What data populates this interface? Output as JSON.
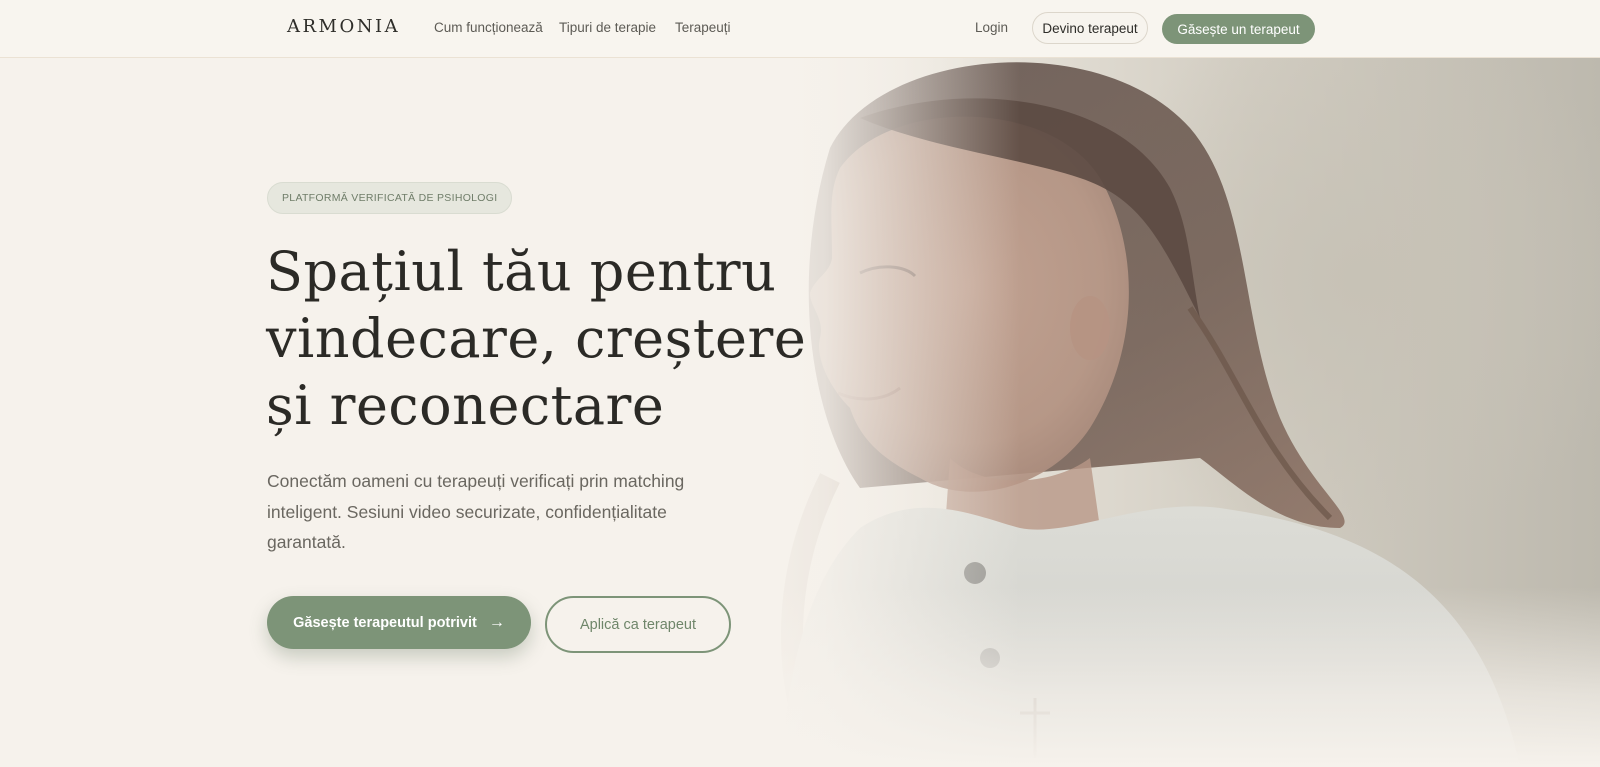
{
  "header": {
    "logo": "ARMONIA",
    "nav": [
      "Cum funcționează",
      "Tipuri de terapie",
      "Terapeuți"
    ],
    "login": "Login",
    "become_therapist": "Devino terapeut",
    "find_therapist": "Găsește un terapeut"
  },
  "hero": {
    "badge": "PLATFORMĂ VERIFICATĂ DE PSIHOLOGI",
    "headline": "Spațiul tău pentru vindecare, creștere și reconectare",
    "subtext": "Conectăm oameni cu terapeuți verificați prin matching inteligent. Sesiuni video securizate, confidențialitate garantată.",
    "primary_cta": "Găsește terapeutul potrivit",
    "secondary_cta": "Aplică ca terapeut"
  },
  "colors": {
    "accent": "#7d9478",
    "background": "#f6f2ec",
    "text": "#2b2a26"
  },
  "icons": {
    "primary_cta_icon": "arrow-right-icon"
  }
}
